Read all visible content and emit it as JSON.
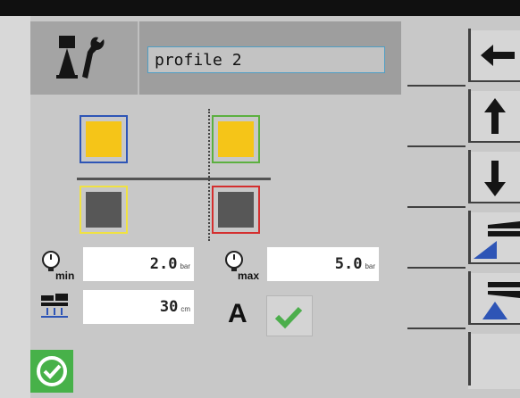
{
  "profile": {
    "name": "profile 2"
  },
  "pressure": {
    "min_sub": "min",
    "min_value": "2.0",
    "min_unit": "bar",
    "max_sub": "max",
    "max_value": "5.0",
    "max_unit": "bar"
  },
  "distance": {
    "value": "30",
    "unit": "cm"
  },
  "auto": {
    "label": "A"
  },
  "icons": {
    "settings": "tools-icon",
    "gauge": "pressure-gauge-icon",
    "distance": "distance-icon",
    "auto_check": "check-icon",
    "confirm": "confirm-check-icon",
    "back": "arrow-left-icon",
    "up": "arrow-up-icon",
    "down": "arrow-down-icon",
    "raise": "raise-icon",
    "lower": "lower-icon"
  },
  "colors": {
    "header": "#9e9e9e",
    "yellow": "#f5c518",
    "blue": "#2e55b6",
    "green": "#5cb040",
    "red": "#d42f2f",
    "confirm": "#47b149"
  }
}
